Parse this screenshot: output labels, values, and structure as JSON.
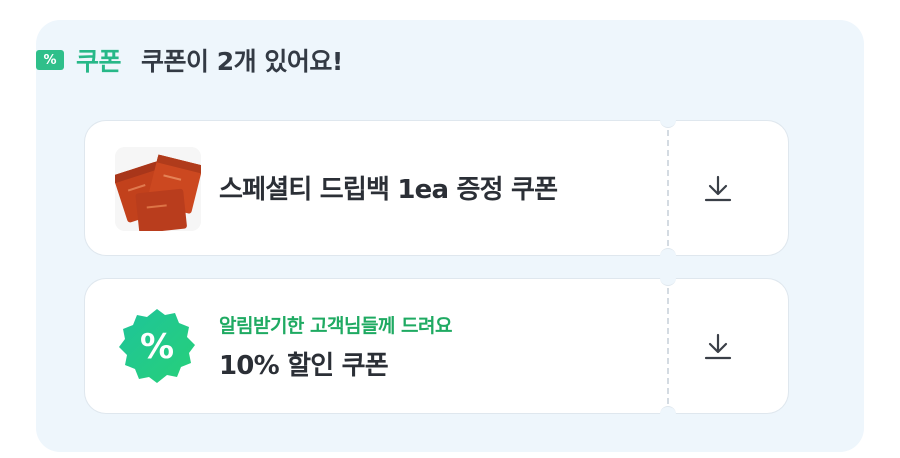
{
  "header": {
    "icon": "percent-tag-icon",
    "icon_glyph": "%",
    "label": "쿠폰",
    "text": "쿠폰이 2개 있어요!",
    "label_color": "#27b888",
    "icon_color": "#2fbf8a"
  },
  "coupons": [
    {
      "title": "스페셜티 드립백 1ea 증정 쿠폰",
      "thumbnail": "drip-bag-product-image",
      "action_icon": "download-icon"
    },
    {
      "subtitle": "알림받기한 고객님들께 드려요",
      "title": "10% 할인 쿠폰",
      "badge_glyph": "%",
      "badge_icon": "percent-badge-icon",
      "action_icon": "download-icon",
      "subtitle_color": "#1faa62"
    }
  ]
}
